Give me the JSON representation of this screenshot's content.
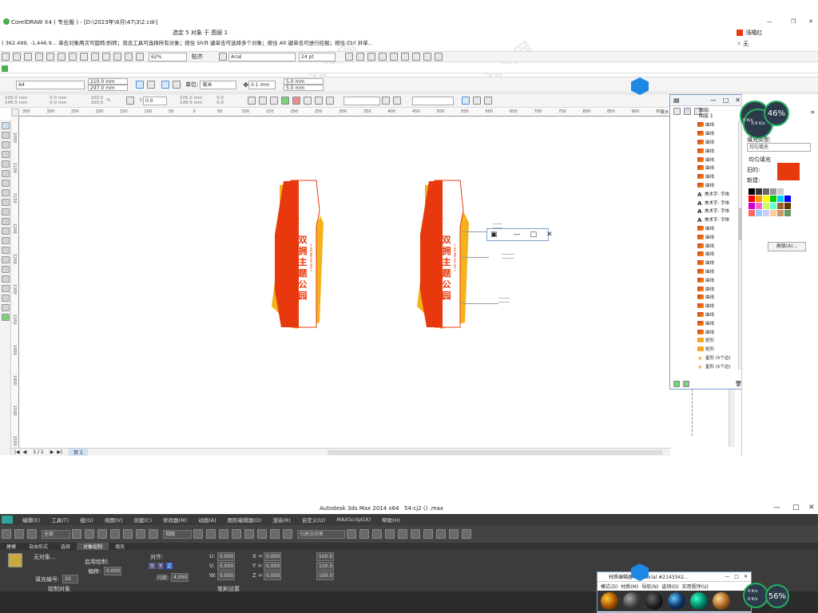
{
  "corel": {
    "app_title": "CorelDRAW X4 ( 专业版 ) - [D:\\2023年\\6月\\47\\3\\2.cdr]",
    "selection_status": "选定 5 对象 于 图层 1",
    "fill_status_label": "浅橘红",
    "outline_status_label": "无",
    "status_text": "( 362.499, -1,446.9... 单击对象两次可旋转/斜转；双击工具可选择所有对象；按住 Shift 键单击可选择多个对象；按住 Alt 键单击可进行挖掘；按住 Ctrl 并单...",
    "zoom": "62%",
    "snap_label": "贴齐",
    "font_name": "Arial",
    "font_size": "24 pt",
    "property_bar": {
      "page_size": "A4",
      "page_width": "210.0 mm",
      "page_height": "297.0 mm",
      "unit_label": "单位:",
      "unit_value": "毫米",
      "nudge": "0.1 mm",
      "dup_x": "5.0 mm",
      "dup_y": "5.0 mm"
    },
    "transform_bar": {
      "x": "105.0 mm",
      "y": "148.5 mm",
      "w": "0.0 mm",
      "h": "0.0 mm",
      "scale_x": "100.0",
      "scale_y": "100.0",
      "pct": "%",
      "rotation": "0.0",
      "cx": "105.0 mm",
      "cy": "148.5 mm",
      "ox": "0.0",
      "oy": "0.0"
    },
    "ruler_h_ticks": [
      "350",
      "300",
      "250",
      "200",
      "150",
      "100",
      "50",
      "0",
      "50",
      "100",
      "150",
      "200",
      "250",
      "300",
      "350",
      "400",
      "450",
      "500",
      "550",
      "600",
      "650",
      "700",
      "750",
      "800",
      "850",
      "900",
      "950"
    ],
    "ruler_v_ticks": [
      "1050",
      "1100",
      "1150",
      "1200",
      "1250",
      "1300",
      "1350",
      "1400",
      "1450",
      "1500",
      "1550"
    ],
    "ruler_unit": "毫米",
    "page_nav": "1 / 1",
    "page_tab": "页 1",
    "sign_text": [
      "双",
      "拥",
      "主",
      "题",
      "公",
      "园"
    ],
    "sign_small_text": "★ 军民团结 鱼水情深 ★",
    "object_manager": {
      "layer_lines": [
        "图层:",
        "图层 1"
      ],
      "objects": [
        "曲线",
        "曲线",
        "曲线",
        "曲线",
        "曲线",
        "曲线",
        "曲线",
        "曲线",
        "美术字: 字体",
        "美术字: 字体",
        "美术字: 字体",
        "美术字: 字体",
        "曲线",
        "曲线",
        "曲线",
        "曲线",
        "曲线",
        "曲线",
        "曲线",
        "曲线",
        "曲线",
        "曲线",
        "曲线",
        "曲线",
        "曲线",
        "矩形",
        "矩形",
        "星形 (5个边)",
        "星形 (5个边)",
        "美术字: 字体"
      ]
    },
    "fill_panel": {
      "fill_type_label": "填充类型:",
      "fill_type_value": "均匀填充",
      "uniform_label": "均匀填充",
      "old_label": "旧的:",
      "new_label": "新建:",
      "advanced_button": "高级(A)..."
    },
    "colors": {
      "accent": "#e8380d",
      "gold": "#f4b21b",
      "fill_swatch": "#e8380d"
    },
    "palette": [
      "#000000",
      "#333333",
      "#666666",
      "#999999",
      "#cccccc",
      "#ffffff",
      "#ff0000",
      "#ff9900",
      "#ffff00",
      "#00cc00",
      "#00ccff",
      "#0000ff",
      "#cc00cc",
      "#ff66cc",
      "#ccff66",
      "#66ffcc",
      "#996633",
      "#663300",
      "#ff6666",
      "#99ccff",
      "#ccccff",
      "#ffcc99",
      "#cc9966",
      "#669966"
    ]
  },
  "netmeter_top": {
    "up": "0.6 K/s",
    "down": "0 K/s",
    "percent": "46%"
  },
  "netmeter_bottom": {
    "up": "0 K/s",
    "down": "0 K/s",
    "percent": "56%"
  },
  "max": {
    "title": "Autodesk 3ds Max 2014 x64",
    "file": "54-cj2 () .max",
    "menu": [
      "编辑(E)",
      "工具(T)",
      "组(G)",
      "视图(V)",
      "创建(C)",
      "修改器(M)",
      "动画(A)",
      "图形编辑器(D)",
      "渲染(R)",
      "自定义(U)",
      "MAXScript(X)",
      "帮助(H)"
    ],
    "selection_filter": "全部",
    "ref_coord": "视图",
    "named_sel": "创建选择集",
    "ribbon_tabs": [
      "建模",
      "自由形式",
      "选择",
      "对象绘制",
      "填充"
    ],
    "ribbon": {
      "paint_on": "无对象...",
      "pick_label": "启用绘制:",
      "fill_count_label": "填充编号:",
      "fill_count": "10",
      "offset_label": "偏移:",
      "offset": "0.000",
      "align_label": "对齐:",
      "spacing_label": "间距:",
      "spacing": "4.000",
      "u_label": "U:",
      "v_label": "V:",
      "w_label": "W:",
      "uvw": "0.000",
      "xyz_labels": [
        "X =",
        "Y =",
        "Z ="
      ],
      "xyz": "0.000",
      "scale": "100.0",
      "group1": "绘制对象",
      "group2": "笔刷设置"
    },
    "material_window": {
      "title": "材质编辑器 - Material #2143342...",
      "menu": [
        "模式(D)",
        "材质(M)",
        "导航(N)",
        "选项(O)",
        "实用程序(U)"
      ]
    }
  },
  "watermark": "我图网"
}
